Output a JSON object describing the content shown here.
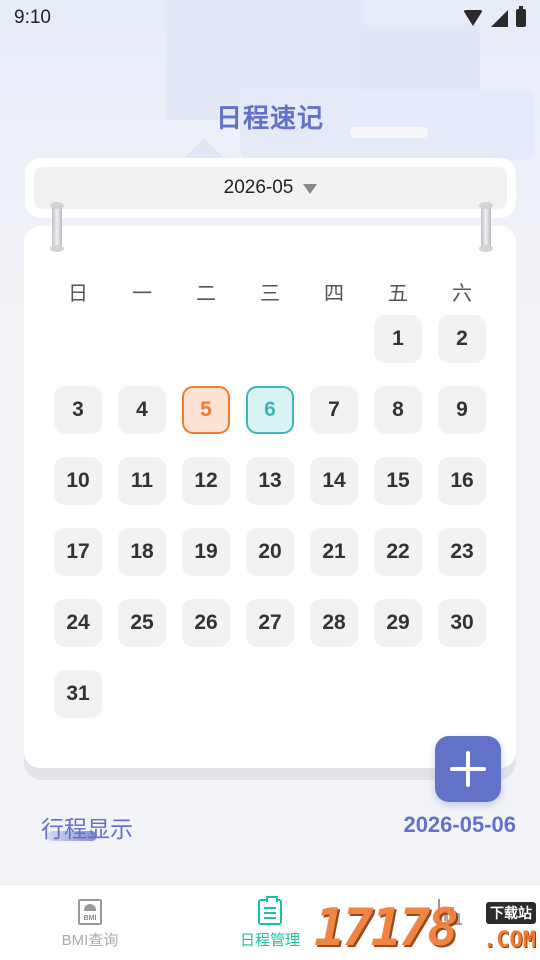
{
  "status_bar": {
    "time": "9:10"
  },
  "header": {
    "title": "日程速记"
  },
  "month_selector": {
    "value": "2026-05"
  },
  "calendar": {
    "weekdays": [
      "日",
      "一",
      "二",
      "三",
      "四",
      "五",
      "六"
    ],
    "today": "5",
    "selected": "6",
    "leading_blanks": 5,
    "days": [
      "1",
      "2",
      "3",
      "4",
      "5",
      "6",
      "7",
      "8",
      "9",
      "10",
      "11",
      "12",
      "13",
      "14",
      "15",
      "16",
      "17",
      "18",
      "19",
      "20",
      "21",
      "22",
      "23",
      "24",
      "25",
      "26",
      "27",
      "28",
      "29",
      "30",
      "31"
    ]
  },
  "schedule": {
    "label": "行程显示",
    "date": "2026-05-06"
  },
  "tabbar": {
    "tabs": [
      {
        "label": "BMI查询",
        "icon": "bmi-scale-icon",
        "active": false,
        "icon_text": "BMI"
      },
      {
        "label": "日程管理",
        "icon": "clipboard-list-icon",
        "active": true
      },
      {
        "label": "",
        "icon": "chart-icon",
        "active": false
      }
    ]
  },
  "watermark": {
    "numbers": "17178",
    "badge": "下载站",
    "suffix": ".COM"
  },
  "colors": {
    "accent": "#6272c9",
    "tab_active": "#17c3a2",
    "today_orange": "#ee7d31",
    "selected_teal": "#3fb5bd"
  }
}
